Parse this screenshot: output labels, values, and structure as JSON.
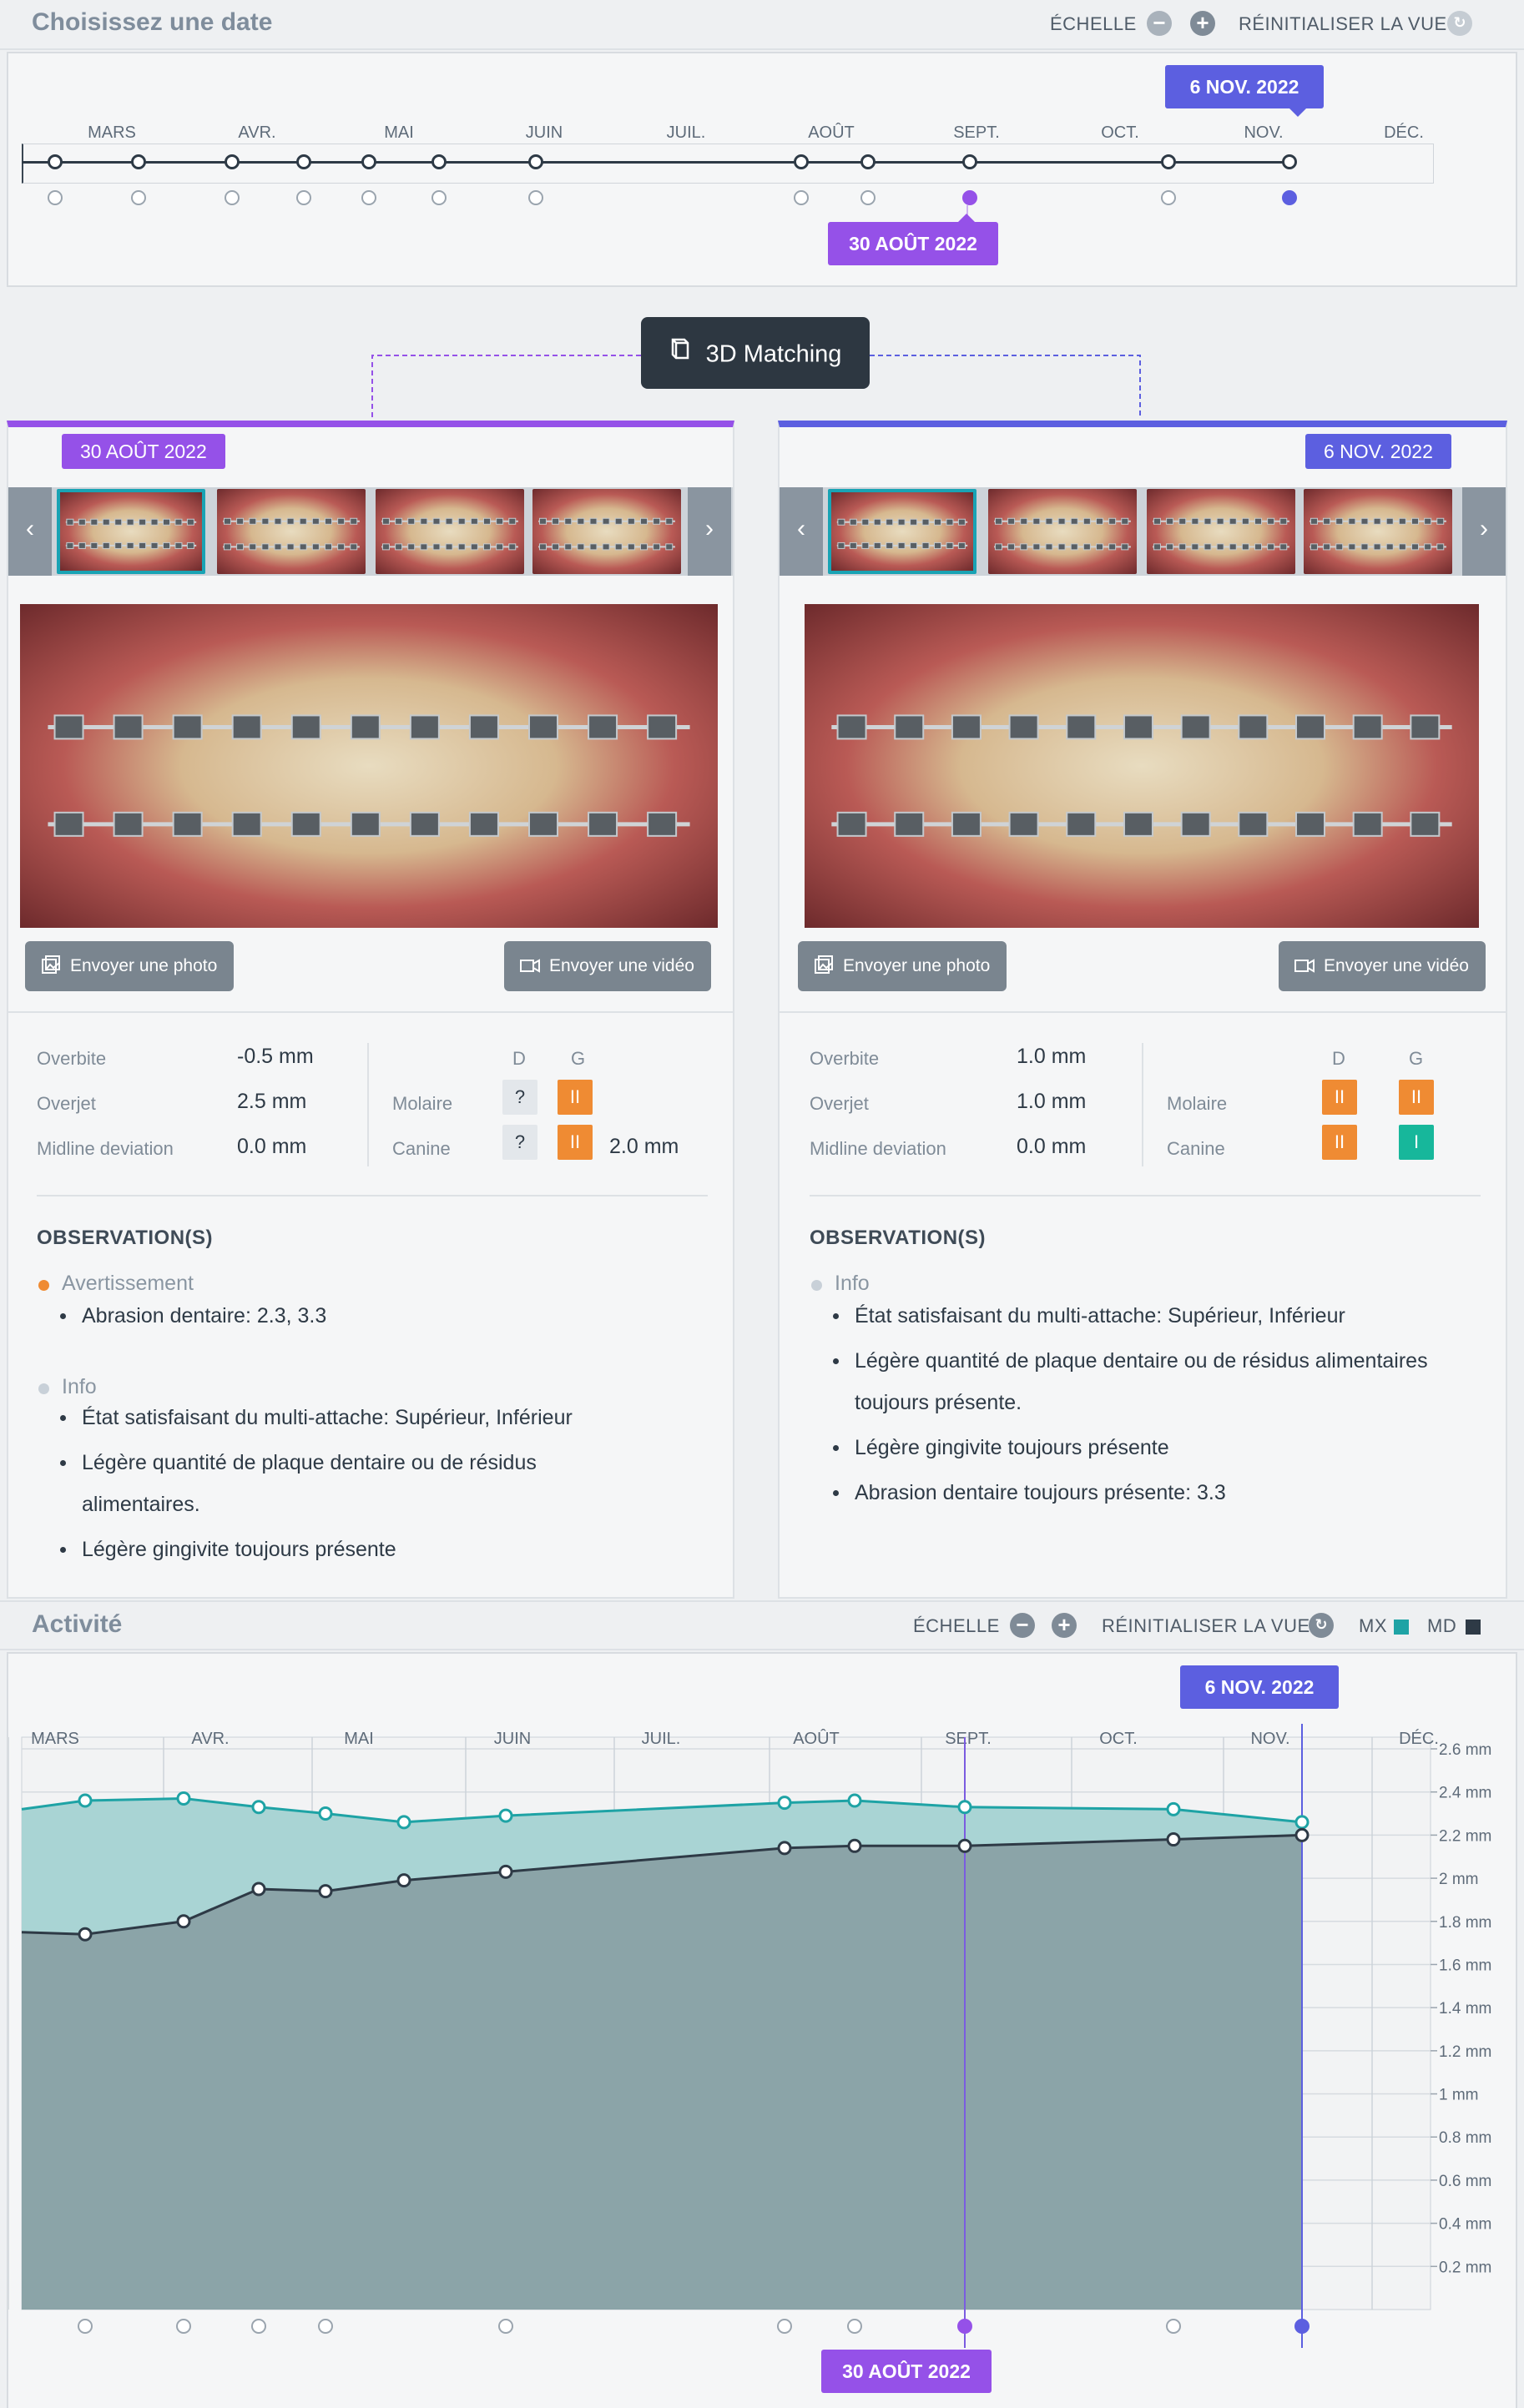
{
  "date_picker": {
    "title": "Choisissez une date",
    "scale_label": "ÉCHELLE",
    "reset_label": "RÉINITIALISER LA VUE",
    "months": [
      "MARS",
      "AVR.",
      "MAI",
      "JUIN",
      "JUIL.",
      "AOÛT",
      "SEPT.",
      "OCT.",
      "NOV.",
      "DÉC."
    ],
    "selected_left": "30 AOÛT 2022",
    "selected_right": "6 NOV. 2022"
  },
  "matching_button": {
    "label": "3D Matching",
    "icon": "cube-icon"
  },
  "colors": {
    "purple": "#9551e8",
    "blue": "#5c5fe0",
    "orange": "#ef8b33",
    "teal": "#17b79b",
    "mx": "#1ea3a5",
    "md": "#2e3a46"
  },
  "left_panel": {
    "date": "30 AOÛT 2022",
    "send_photo": "Envoyer une photo",
    "send_video": "Envoyer une vidéo",
    "metrics": [
      {
        "label": "Overbite",
        "value": "-0.5 mm"
      },
      {
        "label": "Overjet",
        "value": "2.5 mm"
      },
      {
        "label": "Midline deviation",
        "value": "0.0 mm"
      }
    ],
    "class_header": {
      "d": "D",
      "g": "G"
    },
    "molaire": {
      "label": "Molaire",
      "d": "?",
      "g": "II"
    },
    "canine": {
      "label": "Canine",
      "d": "?",
      "g": "II",
      "extra": "2.0 mm"
    },
    "observations_title": "OBSERVATION(S)",
    "warning_label": "Avertissement",
    "warning_items": [
      "Abrasion dentaire: 2.3, 3.3"
    ],
    "info_label": "Info",
    "info_items": [
      "État satisfaisant du multi-attache: Supérieur, Inférieur",
      "Légère quantité de plaque dentaire ou de résidus",
      "alimentaires.",
      "Légère gingivite toujours présente"
    ]
  },
  "right_panel": {
    "date": "6 NOV. 2022",
    "send_photo": "Envoyer une photo",
    "send_video": "Envoyer une vidéo",
    "metrics": [
      {
        "label": "Overbite",
        "value": "1.0 mm"
      },
      {
        "label": "Overjet",
        "value": "1.0 mm"
      },
      {
        "label": "Midline deviation",
        "value": "0.0 mm"
      }
    ],
    "class_header": {
      "d": "D",
      "g": "G"
    },
    "molaire": {
      "label": "Molaire",
      "d": "II",
      "g": "II"
    },
    "canine": {
      "label": "Canine",
      "d": "II",
      "g": "I"
    },
    "observations_title": "OBSERVATION(S)",
    "info_label": "Info",
    "info_items": [
      "État satisfaisant du multi-attache: Supérieur, Inférieur",
      "Légère quantité de plaque dentaire ou de résidus alimentaires",
      "toujours présente.",
      "Légère gingivite toujours présente",
      "Abrasion dentaire toujours présente: 3.3"
    ]
  },
  "activity": {
    "title": "Activité",
    "scale_label": "ÉCHELLE",
    "reset_label": "RÉINITIALISER LA VUE",
    "legend_mx": "MX",
    "legend_md": "MD",
    "flag_top": "6 NOV. 2022",
    "flag_bottom": "30 AOÛT 2022"
  },
  "chart_data": {
    "type": "area",
    "x_labels": [
      "MARS",
      "AVR.",
      "MAI",
      "JUIN",
      "JUIL.",
      "AOÛT",
      "SEPT.",
      "OCT.",
      "NOV.",
      "DÉC."
    ],
    "y_tick_labels": [
      "2.6 mm",
      "2.4 mm",
      "2.2 mm",
      "2 mm",
      "1.8 mm",
      "1.6 mm",
      "1.4 mm",
      "1.2 mm",
      "1 mm",
      "0.8 mm",
      "0.6 mm",
      "0.4 mm",
      "0.2 mm"
    ],
    "ylim": [
      0,
      2.6
    ],
    "series": [
      {
        "name": "MX",
        "values": [
          2.32,
          2.36,
          2.37,
          2.33,
          2.3,
          2.26,
          2.29,
          2.35,
          2.36,
          2.33,
          2.32,
          2.26
        ]
      },
      {
        "name": "MD",
        "values": [
          1.75,
          1.74,
          1.8,
          1.95,
          1.94,
          1.99,
          2.03,
          2.14,
          2.15,
          2.15,
          2.18,
          2.2
        ]
      }
    ]
  }
}
